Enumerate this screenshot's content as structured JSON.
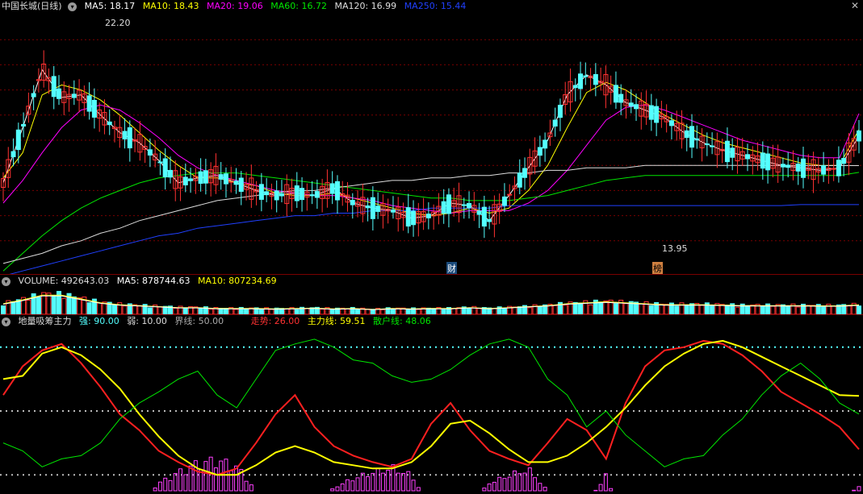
{
  "colors": {
    "bull": "#ff3232",
    "bear": "#54ffff",
    "ma5": "#ffffff",
    "ma10": "#ffff00",
    "ma20": "#ff00ff",
    "ma60": "#00e600",
    "ma120": "#dddddd",
    "ma250": "#2040ff",
    "grid": "#7a0000"
  },
  "price_header": {
    "title": "中国长城(日线)",
    "ma5": "MA5: 18.17",
    "ma10": "MA10: 18.43",
    "ma20": "MA20: 19.06",
    "ma60": "MA60: 16.72",
    "ma120": "MA120: 16.99",
    "ma250": "MA250: 15.44",
    "high_label": "22.20",
    "low_label": "13.95",
    "marker_cai": "财",
    "marker_bang": "榜"
  },
  "volume_header": {
    "volume": "VOLUME: 492643.03",
    "ma5": "MA5: 878744.63",
    "ma10": "MA10: 807234.69"
  },
  "indicator_header": {
    "title": "地量吸筹主力",
    "strong": "强: 90.00",
    "weak": "弱: 10.00",
    "boundary": "界线: 50.00",
    "trend": "走势: 26.00",
    "main": "主力线: 59.51",
    "retail": "散户线: 48.06"
  },
  "chart_data": [
    {
      "type": "line",
      "x": [
        0,
        4,
        8,
        12,
        16,
        20,
        24,
        28,
        32,
        36,
        40,
        44,
        48,
        52,
        56,
        60,
        64,
        68,
        72,
        76,
        80,
        84,
        88,
        92,
        96,
        100,
        104,
        108,
        112,
        116,
        120,
        124,
        128,
        132,
        136,
        140,
        144,
        148,
        152,
        156,
        160,
        164,
        168,
        172,
        176
      ],
      "series": [
        {
          "name": "MA5",
          "values": [
            16.3,
            18.5,
            20.8,
            19.7,
            19.8,
            19.0,
            18.3,
            17.9,
            17.2,
            16.3,
            16.5,
            16.6,
            16.3,
            16.0,
            15.8,
            15.9,
            15.8,
            16.1,
            15.5,
            15.3,
            15.2,
            14.9,
            15.0,
            15.5,
            15.4,
            14.8,
            15.8,
            16.9,
            18.0,
            19.8,
            20.6,
            20.2,
            19.5,
            19.2,
            18.9,
            18.3,
            17.9,
            17.6,
            17.4,
            17.2,
            17.0,
            16.9,
            16.8,
            16.9,
            18.17
          ]
        },
        {
          "name": "MA10",
          "values": [
            16.5,
            17.5,
            19.8,
            20.2,
            20.0,
            19.6,
            19.0,
            18.3,
            17.6,
            17.0,
            16.5,
            16.5,
            16.3,
            16.2,
            15.9,
            15.8,
            15.8,
            15.9,
            15.7,
            15.5,
            15.3,
            15.1,
            15.0,
            15.1,
            15.3,
            15.1,
            15.3,
            16.0,
            17.0,
            18.5,
            19.9,
            20.3,
            20.0,
            19.5,
            19.0,
            18.6,
            18.2,
            17.9,
            17.7,
            17.5,
            17.3,
            17.1,
            17.0,
            17.0,
            18.43
          ]
        },
        {
          "name": "MA20",
          "values": [
            15.5,
            16.4,
            17.5,
            18.5,
            19.2,
            19.4,
            19.2,
            18.7,
            18.1,
            17.4,
            16.9,
            16.6,
            16.4,
            16.2,
            16.0,
            15.9,
            15.8,
            15.8,
            15.7,
            15.6,
            15.4,
            15.3,
            15.2,
            15.1,
            15.2,
            15.2,
            15.2,
            15.5,
            16.0,
            16.8,
            17.8,
            18.8,
            19.3,
            19.4,
            19.2,
            18.9,
            18.6,
            18.3,
            18.0,
            17.8,
            17.6,
            17.4,
            17.3,
            17.3,
            19.06
          ]
        },
        {
          "name": "MA60",
          "values": [
            12.8,
            13.5,
            14.2,
            14.8,
            15.3,
            15.7,
            16.0,
            16.3,
            16.5,
            16.6,
            16.7,
            16.7,
            16.7,
            16.6,
            16.5,
            16.4,
            16.3,
            16.2,
            16.1,
            16.0,
            15.9,
            15.8,
            15.7,
            15.7,
            15.6,
            15.6,
            15.6,
            15.7,
            15.8,
            16.0,
            16.2,
            16.4,
            16.5,
            16.6,
            16.6,
            16.6,
            16.6,
            16.6,
            16.6,
            16.6,
            16.6,
            16.6,
            16.6,
            16.6,
            16.72
          ]
        },
        {
          "name": "MA120",
          "values": [
            13.1,
            13.3,
            13.5,
            13.8,
            14.0,
            14.3,
            14.5,
            14.8,
            15.0,
            15.2,
            15.4,
            15.6,
            15.7,
            15.8,
            15.9,
            16.0,
            16.0,
            16.1,
            16.2,
            16.3,
            16.4,
            16.4,
            16.5,
            16.5,
            16.6,
            16.6,
            16.7,
            16.7,
            16.8,
            16.8,
            16.9,
            16.9,
            16.9,
            17.0,
            17.0,
            17.0,
            17.0,
            17.0,
            17.0,
            17.0,
            16.99,
            16.99,
            16.99,
            16.99,
            16.99
          ]
        },
        {
          "name": "MA250",
          "values": [
            12.6,
            12.8,
            13.0,
            13.2,
            13.4,
            13.6,
            13.8,
            14.0,
            14.2,
            14.3,
            14.5,
            14.6,
            14.7,
            14.8,
            14.9,
            15.0,
            15.0,
            15.1,
            15.1,
            15.2,
            15.2,
            15.2,
            15.3,
            15.3,
            15.3,
            15.3,
            15.4,
            15.4,
            15.4,
            15.4,
            15.4,
            15.4,
            15.4,
            15.4,
            15.4,
            15.4,
            15.4,
            15.4,
            15.4,
            15.4,
            15.4,
            15.44,
            15.44,
            15.44,
            15.44
          ]
        }
      ],
      "ylim": [
        13.0,
        23.0
      ]
    },
    {
      "type": "bar",
      "x": [
        0,
        4,
        8,
        12,
        16,
        20,
        24,
        28,
        32,
        36,
        40,
        44,
        48,
        52,
        56,
        60,
        64,
        68,
        72,
        76,
        80,
        84,
        88,
        92,
        96,
        100,
        104,
        108,
        112,
        116,
        120,
        124,
        128,
        132,
        136,
        140,
        144,
        148,
        152,
        156,
        160,
        164,
        168,
        172,
        176
      ],
      "values": [
        0.55,
        0.75,
        1.0,
        1.0,
        0.8,
        0.6,
        0.5,
        0.45,
        0.4,
        0.35,
        0.35,
        0.3,
        0.3,
        0.3,
        0.28,
        0.3,
        0.32,
        0.28,
        0.3,
        0.25,
        0.3,
        0.28,
        0.3,
        0.3,
        0.35,
        0.3,
        0.35,
        0.4,
        0.45,
        0.55,
        0.6,
        0.65,
        0.6,
        0.55,
        0.5,
        0.5,
        0.5,
        0.48,
        0.45,
        0.45,
        0.45,
        0.45,
        0.44,
        0.44,
        0.49
      ],
      "ylim": [
        0,
        1.3
      ]
    },
    {
      "type": "line",
      "x": [
        0,
        4,
        8,
        12,
        16,
        20,
        24,
        28,
        32,
        36,
        40,
        44,
        48,
        52,
        56,
        60,
        64,
        68,
        72,
        76,
        80,
        84,
        88,
        92,
        96,
        100,
        104,
        108,
        112,
        116,
        120,
        124,
        128,
        132,
        136,
        140,
        144,
        148,
        152,
        156,
        160,
        164,
        168,
        172,
        176
      ],
      "series": [
        {
          "name": "走势",
          "values": [
            60,
            78,
            88,
            92,
            80,
            65,
            48,
            38,
            25,
            18,
            12,
            10,
            14,
            30,
            48,
            60,
            40,
            28,
            22,
            18,
            15,
            20,
            42,
            55,
            38,
            25,
            20,
            16,
            30,
            45,
            38,
            20,
            55,
            78,
            88,
            90,
            94,
            92,
            85,
            75,
            62,
            55,
            48,
            40,
            26
          ]
        },
        {
          "name": "主力线",
          "values": [
            70,
            72,
            86,
            90,
            85,
            76,
            64,
            48,
            34,
            22,
            14,
            10,
            10,
            16,
            24,
            28,
            24,
            18,
            16,
            14,
            14,
            18,
            28,
            42,
            44,
            36,
            26,
            18,
            18,
            22,
            30,
            40,
            52,
            66,
            78,
            86,
            92,
            94,
            90,
            84,
            78,
            72,
            66,
            60,
            59.51
          ]
        },
        {
          "name": "散户线",
          "values": [
            30,
            25,
            15,
            20,
            22,
            30,
            45,
            55,
            62,
            70,
            75,
            60,
            52,
            70,
            88,
            92,
            95,
            90,
            82,
            80,
            72,
            68,
            70,
            76,
            85,
            92,
            95,
            90,
            70,
            60,
            40,
            50,
            35,
            25,
            15,
            20,
            22,
            35,
            45,
            60,
            72,
            80,
            70,
            55,
            48.06
          ]
        },
        {
          "name": "强",
          "values": [
            90
          ]
        },
        {
          "name": "弱",
          "values": [
            10
          ]
        },
        {
          "name": "界线",
          "values": [
            50
          ]
        }
      ],
      "ylim": [
        0,
        100
      ]
    }
  ]
}
